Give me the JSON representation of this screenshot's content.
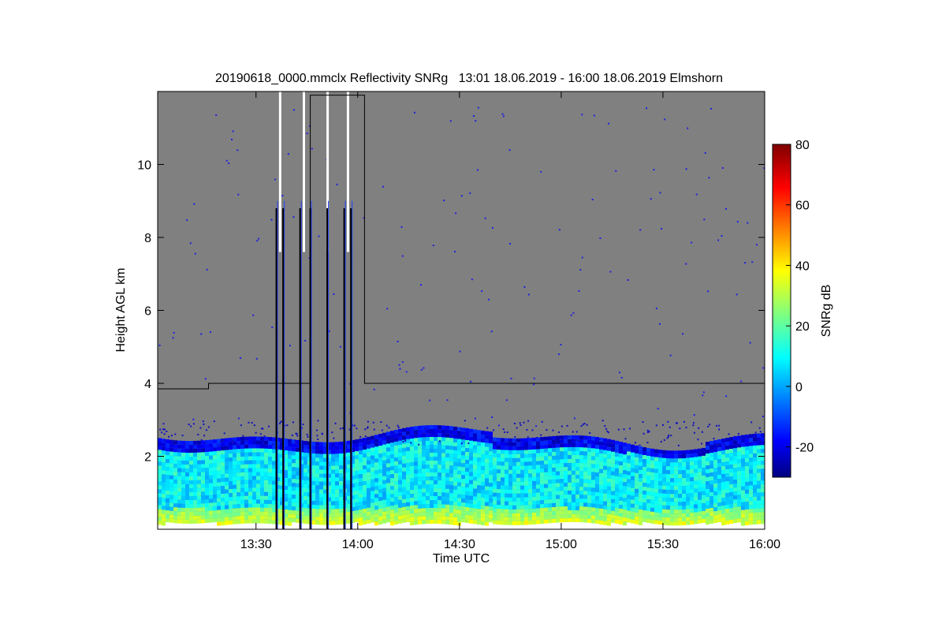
{
  "chart_data": {
    "type": "heatmap",
    "title": "20190618_0000.mmclx Reflectivity SNRg   13:01 18.06.2019 - 16:00 18.06.2019 Elmshorn",
    "xlabel": "Time UTC",
    "ylabel": "Height AGL km",
    "colorbar_label": "SNRg dB",
    "x_range": [
      "13:01",
      "16:00"
    ],
    "ylim": [
      0,
      12
    ],
    "x_ticks": [
      "13:30",
      "14:00",
      "14:30",
      "15:00",
      "15:30",
      "16:00"
    ],
    "y_ticks": [
      "2",
      "4",
      "6",
      "8",
      "10"
    ],
    "colorbar_range": [
      -30,
      80
    ],
    "colorbar_ticks": [
      "-20",
      "0",
      "20",
      "40",
      "60",
      "80"
    ],
    "colormap": "jet",
    "background_color": "#808080",
    "echo_layer": {
      "bottom_km": 0.2,
      "top_km": 2.6,
      "near_surface_snr_db": 35,
      "mid_layer_snr_db": 10,
      "top_edge_snr_db": -25
    },
    "range_limit_line": {
      "color": "#000000",
      "points": [
        [
          "13:01",
          3.85
        ],
        [
          "13:16",
          3.85
        ],
        [
          "13:16",
          4.0
        ],
        [
          "13:46",
          4.0
        ],
        [
          "13:46",
          11.9
        ],
        [
          "14:02",
          11.9
        ],
        [
          "14:02",
          4.0
        ],
        [
          "16:00",
          4.0
        ]
      ]
    },
    "gap_times": [
      "13:37",
      "13:44",
      "13:51",
      "13:57"
    ],
    "clutter_spikes_times": [
      "13:36",
      "13:38",
      "13:43",
      "13:46",
      "13:51",
      "13:56",
      "13:58"
    ],
    "grid": false
  }
}
